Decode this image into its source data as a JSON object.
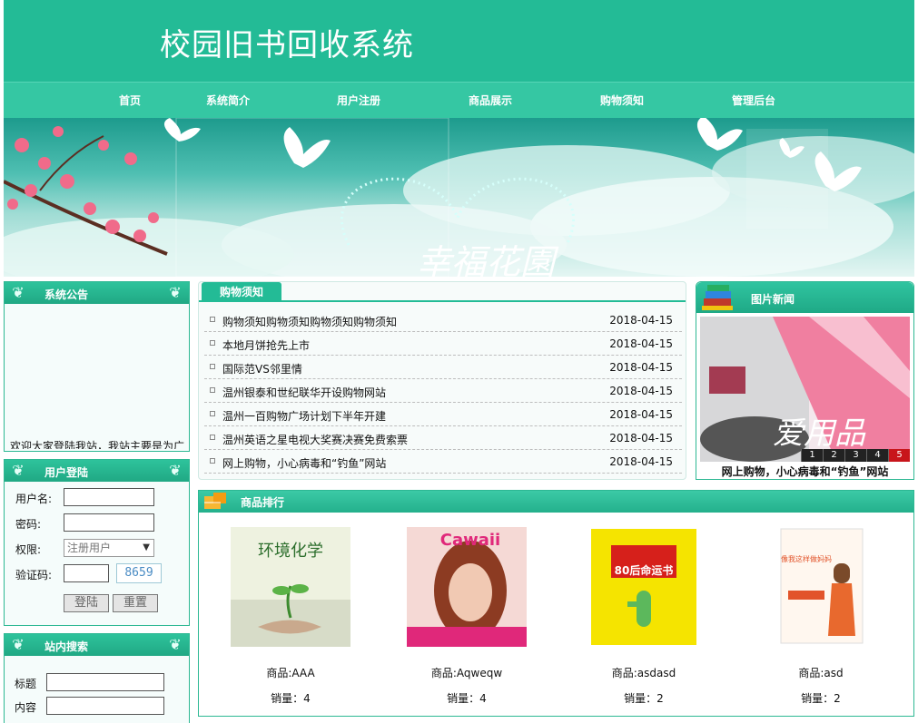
{
  "header": {
    "title": "校园旧书回收系统"
  },
  "nav": {
    "items": [
      "首页",
      "系统简介",
      "用户注册",
      "商品展示",
      "购物须知",
      "管理后台"
    ]
  },
  "banner": {
    "text": "幸福花園"
  },
  "notice_panel": {
    "title": "系统公告",
    "marquee": "欢迎大家登陆我站，我站主要是为广大"
  },
  "login_panel": {
    "title": "用户登陆",
    "username_label": "用户名:",
    "password_label": "密码:",
    "role_label": "权限:",
    "role_value": "注册用户",
    "captcha_label": "验证码:",
    "captcha_code": "8659",
    "login_button": "登陆",
    "reset_button": "重置"
  },
  "search_panel": {
    "title": "站内搜索",
    "title_label": "标题",
    "content_label": "内容"
  },
  "middle": {
    "tab": "购物须知",
    "news": [
      {
        "title": "购物须知购物须知购物须知购物须知",
        "date": "2018-04-15"
      },
      {
        "title": "本地月饼抢先上市",
        "date": "2018-04-15"
      },
      {
        "title": "国际范VS邻里情",
        "date": "2018-04-15"
      },
      {
        "title": "温州银泰和世纪联华开设购物网站",
        "date": "2018-04-15"
      },
      {
        "title": "温州一百购物广场计划下半年开建",
        "date": "2018-04-15"
      },
      {
        "title": "温州英语之星电视大奖赛决赛免费索票",
        "date": "2018-04-15"
      },
      {
        "title": "网上购物，小心病毒和“钓鱼”网站",
        "date": "2018-04-15"
      }
    ]
  },
  "picture_news": {
    "title": "图片新闻",
    "image_text": "爱用品",
    "pages": [
      "1",
      "2",
      "3",
      "4",
      "5"
    ],
    "caption": "网上购物，小心病毒和“钓鱼”网站"
  },
  "goods": {
    "title": "商品排行",
    "items": [
      {
        "name": "商品:AAA",
        "sales": "销量：4",
        "cover_text": "环境化学"
      },
      {
        "name": "商品:Aqweqw",
        "sales": "销量：4",
        "cover_text": "Cawaii"
      },
      {
        "name": "商品:asdasd",
        "sales": "销量：2",
        "cover_text": "80后命运书"
      },
      {
        "name": "商品:asd",
        "sales": "销量：2",
        "cover_text": "像我这样做妈妈"
      }
    ]
  }
}
